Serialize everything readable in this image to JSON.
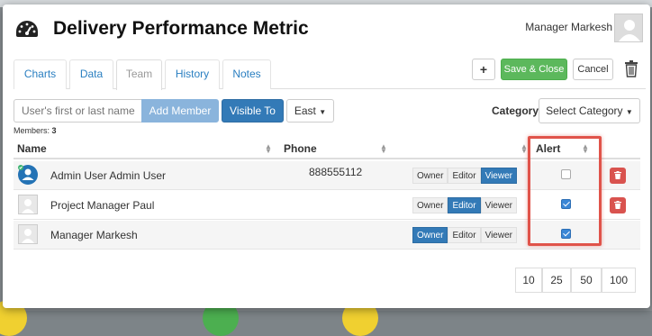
{
  "modal": {
    "title": "Delivery Performance Metric",
    "user_name": "Manager Markesh"
  },
  "tabs": [
    {
      "label": "Charts",
      "active": false
    },
    {
      "label": "Data",
      "active": false
    },
    {
      "label": "Team",
      "active": true
    },
    {
      "label": "History",
      "active": false
    },
    {
      "label": "Notes",
      "active": false
    }
  ],
  "header_actions": {
    "add_label": "+",
    "save_label": "Save & Close",
    "cancel_label": "Cancel"
  },
  "controls": {
    "search_placeholder": "User's first or last name",
    "add_member_label": "Add Member",
    "visible_to_label": "Visible To",
    "region_label": "East",
    "category_label": "Category",
    "category_select": "Select Category"
  },
  "members": {
    "label": "Members:",
    "count": "3"
  },
  "table": {
    "columns": [
      "Name",
      "Phone",
      "Alert"
    ],
    "rows": [
      {
        "name": "Admin User Admin User",
        "phone": "888555112",
        "roles": [
          "Owner",
          "Editor",
          "Viewer"
        ],
        "active_role": "Viewer",
        "alert": false
      },
      {
        "name": "Project Manager Paul",
        "phone": "",
        "roles": [
          "Owner",
          "Editor",
          "Viewer"
        ],
        "active_role": "Editor",
        "alert": true
      },
      {
        "name": "Manager Markesh",
        "phone": "",
        "roles": [
          "Owner",
          "Editor",
          "Viewer"
        ],
        "active_role": "Owner",
        "alert": true
      }
    ]
  },
  "pagination": [
    "10",
    "25",
    "50",
    "100"
  ],
  "colors": {
    "primary": "#337ab7",
    "success": "#5cb85c",
    "danger": "#d9534f",
    "highlight": "#e0534a"
  }
}
